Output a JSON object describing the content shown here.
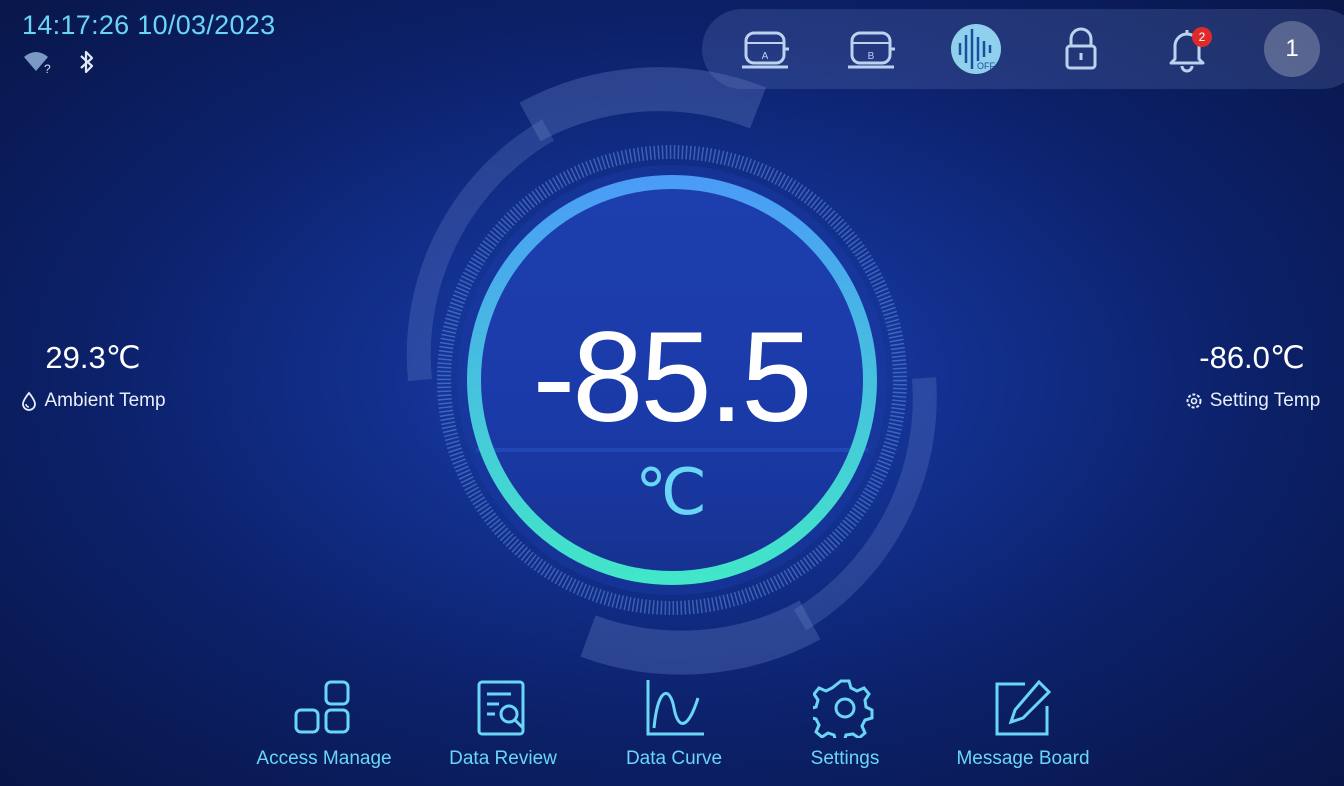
{
  "status": {
    "datetime": "14:17:26 10/03/2023",
    "icons": [
      "wifi-unknown-icon",
      "bluetooth-icon"
    ]
  },
  "topbar": {
    "icons": [
      {
        "name": "compressor-a-icon",
        "label": "A"
      },
      {
        "name": "compressor-b-icon",
        "label": "B"
      },
      {
        "name": "sound-off-icon",
        "label": "OFF"
      },
      {
        "name": "lock-icon"
      },
      {
        "name": "bell-icon"
      }
    ],
    "notification_count": "2",
    "user_number": "1"
  },
  "ambient": {
    "value": "29.3℃",
    "label": "Ambient Temp",
    "icon": "drop-icon"
  },
  "setting": {
    "value": "-86.0℃",
    "label": "Setting Temp",
    "icon": "gear-small-icon"
  },
  "main": {
    "temperature": "-85.5",
    "unit": "℃"
  },
  "nav": [
    {
      "label": "Access Manage",
      "icon": "grid-squares-icon"
    },
    {
      "label": "Data Review",
      "icon": "document-search-icon"
    },
    {
      "label": "Data Curve",
      "icon": "curve-chart-icon"
    },
    {
      "label": "Settings",
      "icon": "gear-icon"
    },
    {
      "label": "Message Board",
      "icon": "edit-icon"
    }
  ],
  "colors": {
    "accent": "#6ad6f6",
    "ring_start": "#4a9cf6",
    "ring_end": "#42e6c8",
    "badge": "#e02a2a"
  }
}
